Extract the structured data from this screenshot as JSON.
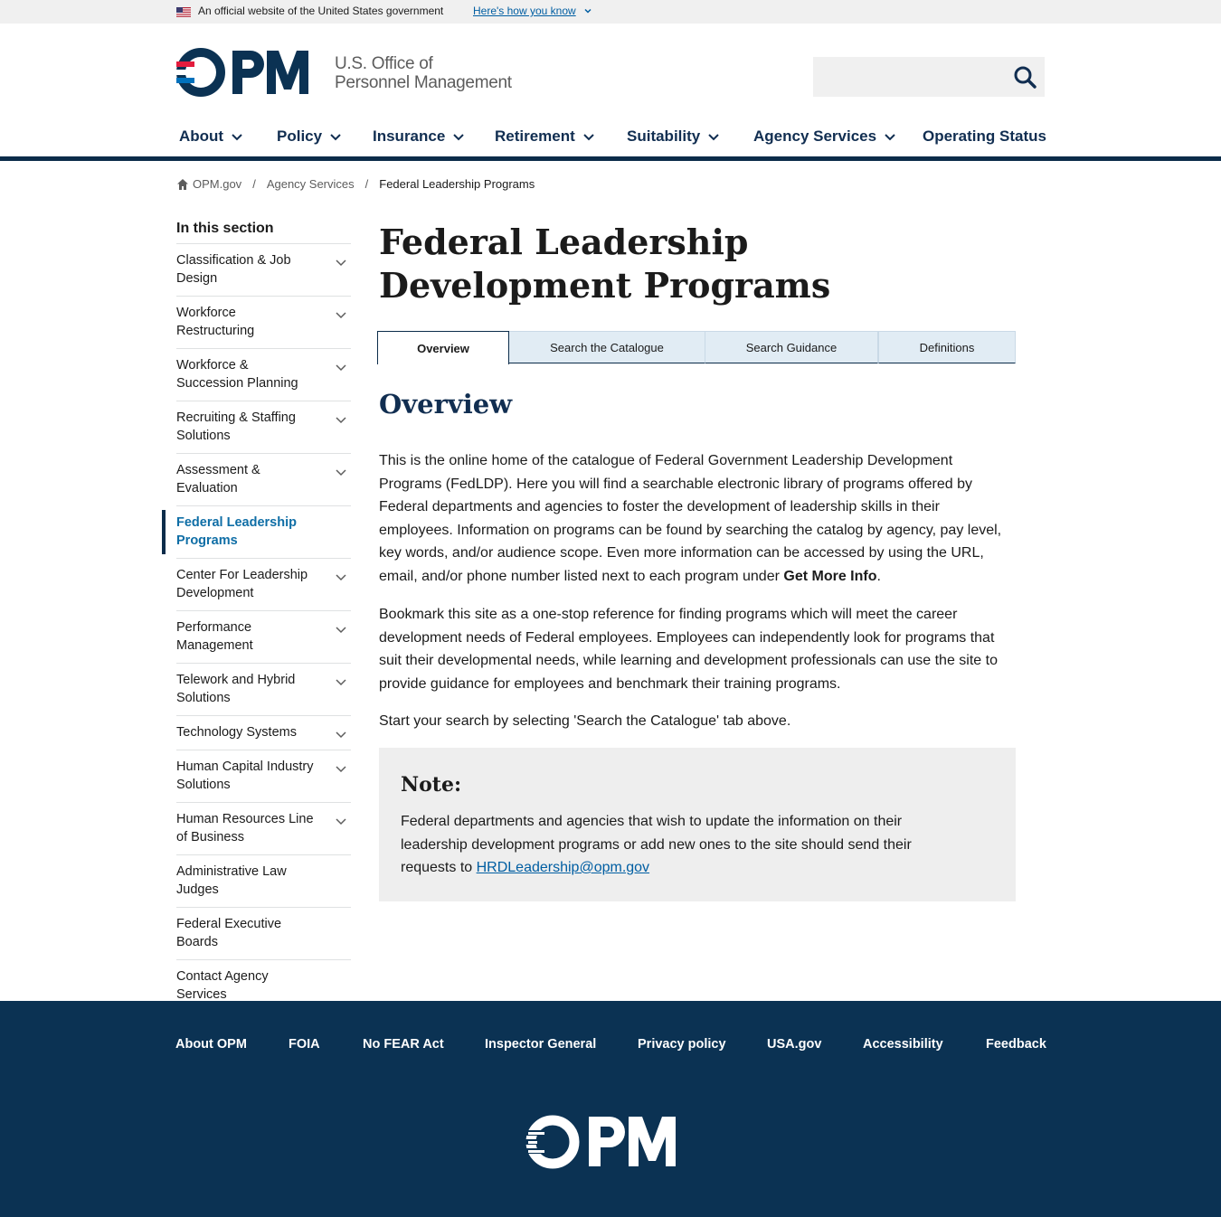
{
  "gov_banner": {
    "text": "An official website of the United States government",
    "link": "Here's how you know"
  },
  "header": {
    "logo_text": "OPM",
    "agency_line1": "U.S. Office of",
    "agency_line2": "Personnel Management",
    "search_placeholder": "",
    "search_value": ""
  },
  "nav": {
    "items": [
      {
        "label": "About",
        "dropdown": true
      },
      {
        "label": "Policy",
        "dropdown": true
      },
      {
        "label": "Insurance",
        "dropdown": true
      },
      {
        "label": "Retirement",
        "dropdown": true
      },
      {
        "label": "Suitability",
        "dropdown": true
      },
      {
        "label": "Agency Services",
        "dropdown": true,
        "active": true
      },
      {
        "label": "Operating Status",
        "dropdown": false
      }
    ]
  },
  "breadcrumb": {
    "home": "OPM.gov",
    "sep": "/",
    "level1": "Agency Services",
    "current": "Federal Leadership Programs"
  },
  "sidebar": {
    "heading": "In this section",
    "items": [
      {
        "label": "Classification & Job Design",
        "expandable": true
      },
      {
        "label": "Workforce Restructuring",
        "expandable": true
      },
      {
        "label": "Workforce & Succession Planning",
        "expandable": true
      },
      {
        "label": "Recruiting & Staffing Solutions",
        "expandable": true
      },
      {
        "label": "Assessment & Evaluation",
        "expandable": true
      },
      {
        "label": "Federal Leadership Programs",
        "expandable": false,
        "active": true
      },
      {
        "label": "Center For Leadership Development",
        "expandable": true
      },
      {
        "label": "Performance Management",
        "expandable": true
      },
      {
        "label": "Telework and Hybrid Solutions",
        "expandable": true
      },
      {
        "label": "Technology Systems",
        "expandable": true
      },
      {
        "label": "Human Capital Industry Solutions",
        "expandable": true
      },
      {
        "label": "Human Resources Line of Business",
        "expandable": true
      },
      {
        "label": "Administrative Law Judges",
        "expandable": false
      },
      {
        "label": "Federal Executive Boards",
        "expandable": false
      },
      {
        "label": "Contact Agency Services",
        "expandable": false
      }
    ]
  },
  "main": {
    "title": "Federal Leadership Development Programs",
    "tabs": [
      {
        "label": "Overview",
        "active": true
      },
      {
        "label": "Search the Catalogue"
      },
      {
        "label": "Search Guidance"
      },
      {
        "label": "Definitions"
      }
    ],
    "section_title": "Overview",
    "para1": "This is the online home of the catalogue of Federal Government Leadership Development Programs (FedLDP). Here you will find a searchable electronic library of programs offered by Federal departments and agencies to foster the development of leadership skills in their employees. Information on programs can be found by searching the catalog by agency, pay level, key words, and/or audience scope. Even more information can be accessed by using the URL, email, and/or phone number listed next to each program under ",
    "para1_bold": "Get More Info",
    "para1_end": ".",
    "para2": "Bookmark this site as a one-stop reference for finding programs which will meet the career development needs of Federal employees. Employees can independently look for programs that suit their developmental needs, while learning and development professionals can use the site to provide guidance for employees and benchmark their training programs.",
    "para3": "Start your search by selecting 'Search the Catalogue' tab above.",
    "note": {
      "title": "Note:",
      "text": "Federal departments and agencies that wish to update the information on their leadership development programs or add new ones to the site should send their requests to ",
      "email": "HRDLeadership@opm.gov"
    }
  },
  "footer": {
    "links": [
      "About OPM",
      "FOIA",
      "No FEAR Act",
      "Inspector General",
      "Privacy policy",
      "USA.gov",
      "Accessibility",
      "Feedback"
    ],
    "logo_text": "OPM"
  },
  "colors": {
    "navy": "#112e51",
    "footer_bg": "#0b3253",
    "accent_teal": "#2fa4c1",
    "link_blue": "#005ea2",
    "active_sidebar": "#0f6ea6",
    "logo_red": "#e31c3d",
    "logo_blue": "#0071bc"
  }
}
